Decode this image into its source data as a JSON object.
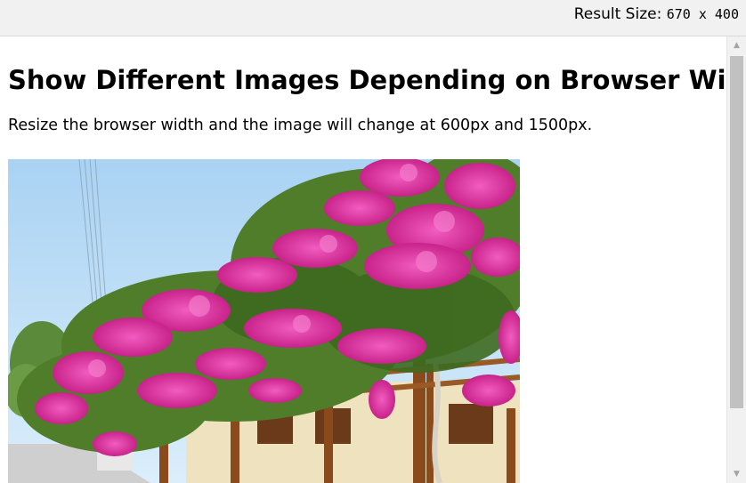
{
  "topbar": {
    "result_label": "Result Size:",
    "result_dims": "670 x 400"
  },
  "page": {
    "heading": "Show Different Images Depending on Browser Width",
    "intro": "Resize the browser width and the image will change at 600px and 1500px."
  },
  "photo": {
    "subject": "bougainvillea flowers over pergola"
  },
  "scrollbar": {
    "up_icon": "▲",
    "down_icon": "▼"
  },
  "colors": {
    "sky": "#bcdcf6",
    "flower_magenta": "#e0359f",
    "foliage": "#4f7d2a",
    "wall": "#efe3bf",
    "wood": "#8a4a1c"
  }
}
